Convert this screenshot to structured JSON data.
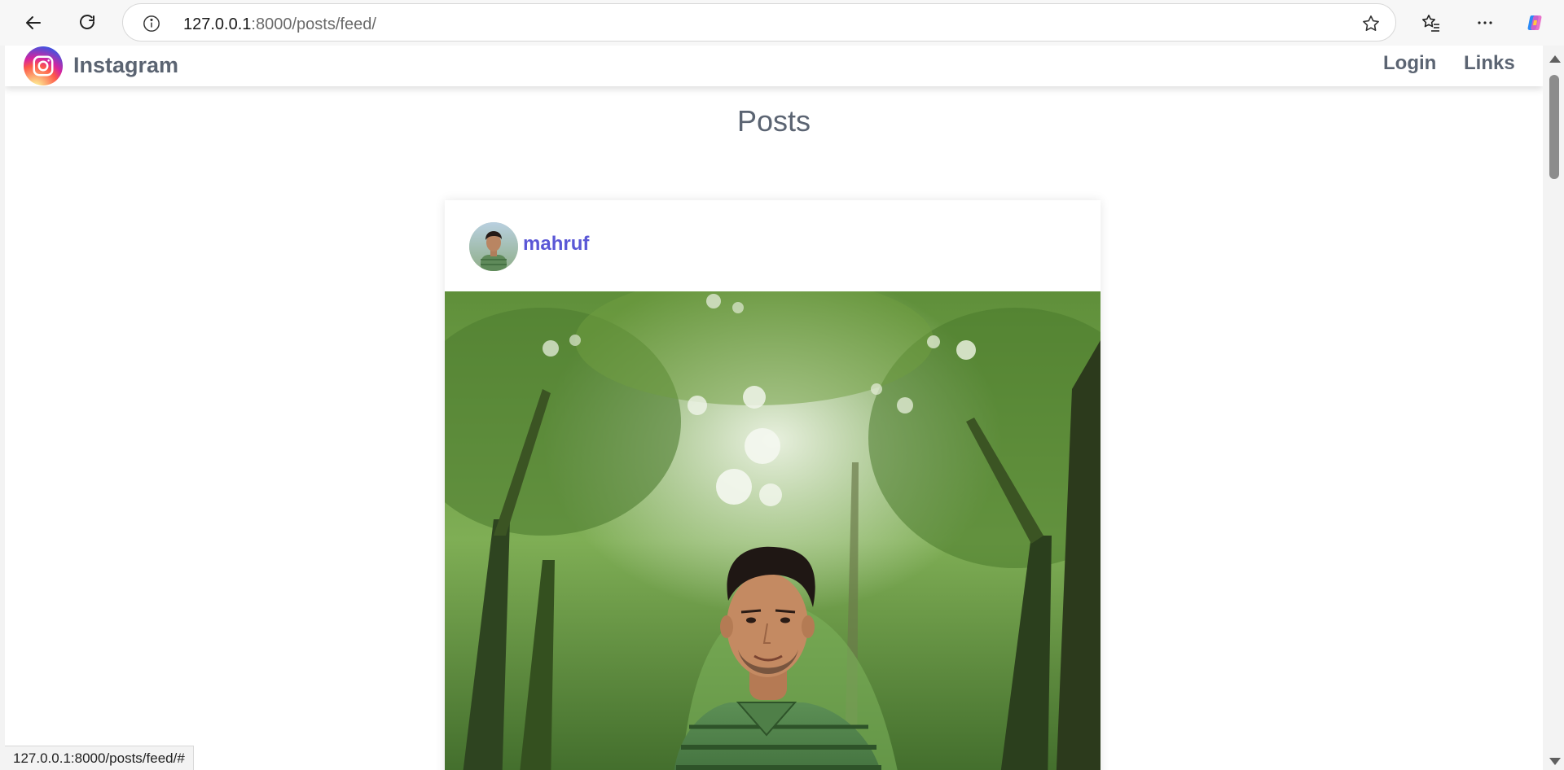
{
  "browser": {
    "url_host": "127.0.0.1",
    "url_path": ":8000/posts/feed/",
    "status_url": "127.0.0.1:8000/posts/feed/#"
  },
  "navbar": {
    "brand": "Instagram",
    "links": [
      "Login",
      "Links"
    ]
  },
  "page": {
    "title": "Posts"
  },
  "post": {
    "username": "mahruf"
  },
  "icons": {
    "back": "arrow-left-icon",
    "refresh": "refresh-icon",
    "info": "info-icon",
    "favorite": "star-icon",
    "favorites_list": "favorites-icon",
    "more": "more-icon",
    "copilot": "copilot-icon",
    "brand": "instagram-icon"
  },
  "colors": {
    "brand_text": "#5b6472",
    "username": "#5a57d6"
  }
}
